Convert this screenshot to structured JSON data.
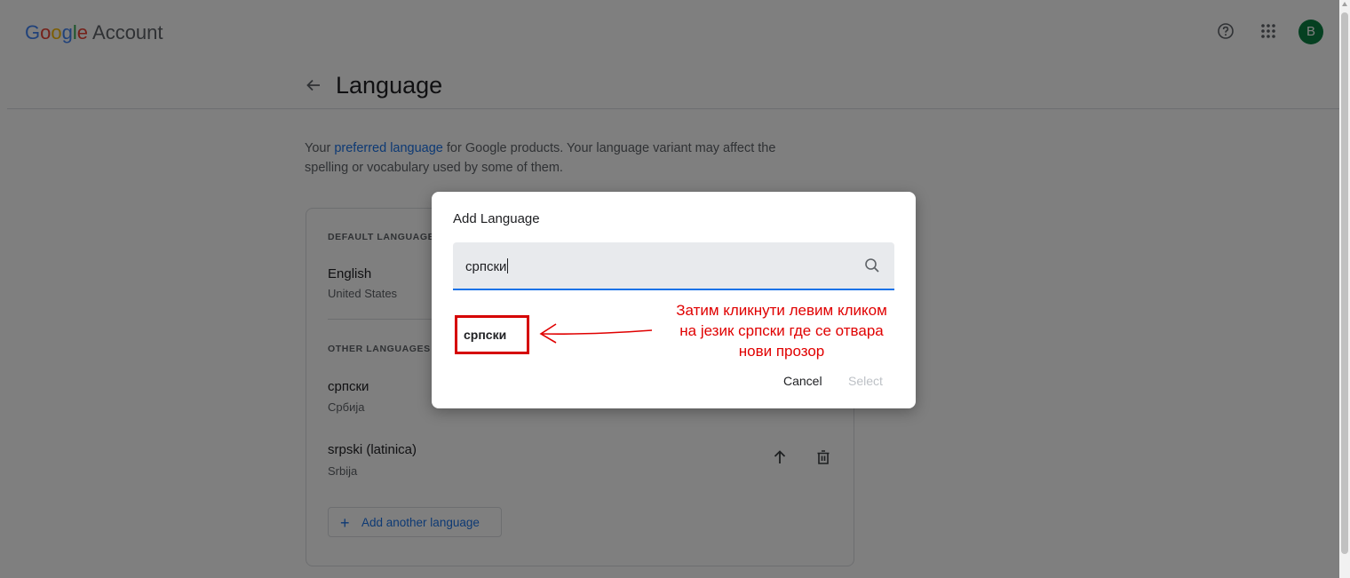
{
  "header": {
    "logo_letters": [
      "G",
      "o",
      "o",
      "g",
      "l",
      "e"
    ],
    "logo_account": "Account",
    "help_icon": "help-circle-icon",
    "apps_icon": "apps-grid-icon",
    "avatar_letter": "B",
    "avatar_color": "#0b8043"
  },
  "page": {
    "title": "Language",
    "back_icon": "arrow-left-icon",
    "intro_before": "Your ",
    "intro_link": "preferred language",
    "intro_after": " for Google products. Your language variant may affect the spelling or vocabulary used by some of them."
  },
  "card": {
    "default_label": "DEFAULT LANGUAGE",
    "default_lang": {
      "name": "English",
      "region": "United States"
    },
    "other_label": "OTHER LANGUAGES Y",
    "other_langs": [
      {
        "name": "српски",
        "region": "Србија"
      },
      {
        "name": "srpski (latinica)",
        "region": "Srbija"
      }
    ],
    "add_button": "Add another language",
    "add_icon": "+"
  },
  "dialog": {
    "title": "Add Language",
    "search_value": "српски",
    "search_icon": "search-icon",
    "result": "српски",
    "cancel": "Cancel",
    "select": "Select"
  },
  "annotation": {
    "line1": "Затим кликнути левим кликом",
    "line2": "на језик српски где се отвара",
    "line3": "нови прозор",
    "color": "#e00000"
  },
  "colors": {
    "accent": "#1a73e8",
    "overlay": "rgba(0,0,0,0.5)"
  }
}
